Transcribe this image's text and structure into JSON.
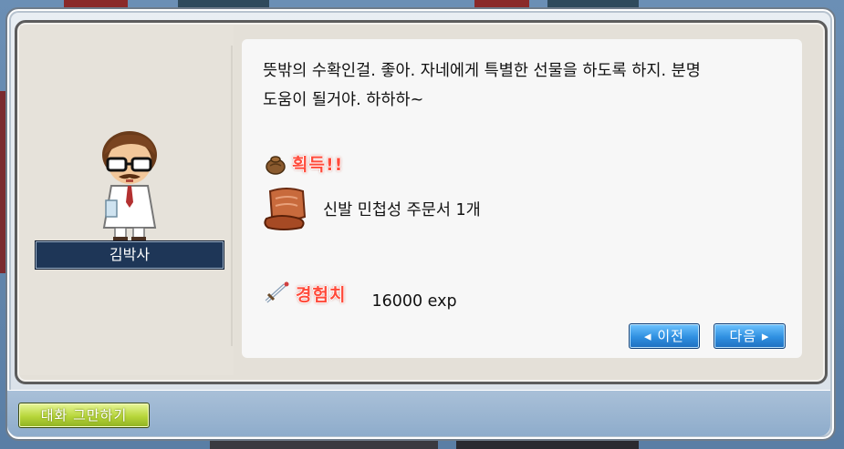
{
  "npc": {
    "name": "김박사"
  },
  "message": {
    "line1": "뜻밖의 수확인걸. 좋아. 자네에게 특별한 선물을 하도록 하지. 분명",
    "line2": "도움이 될거야. 하하하~"
  },
  "rewards": {
    "obtain_label": "획득!!",
    "item": {
      "icon": "scroll-icon",
      "text": "신발 민첩성 주문서 1개"
    },
    "exp_label": "경험치",
    "exp_icon": "sword-icon",
    "exp_text": "16000 exp"
  },
  "buttons": {
    "prev": "◂ 이전",
    "next": "다음 ▸",
    "end_chat": "대화 그만하기"
  },
  "colors": {
    "accent_red": "#ff4a3a",
    "button_blue": "#2f8fe0",
    "button_green": "#b7d63a",
    "nameplate": "#1e3657"
  }
}
